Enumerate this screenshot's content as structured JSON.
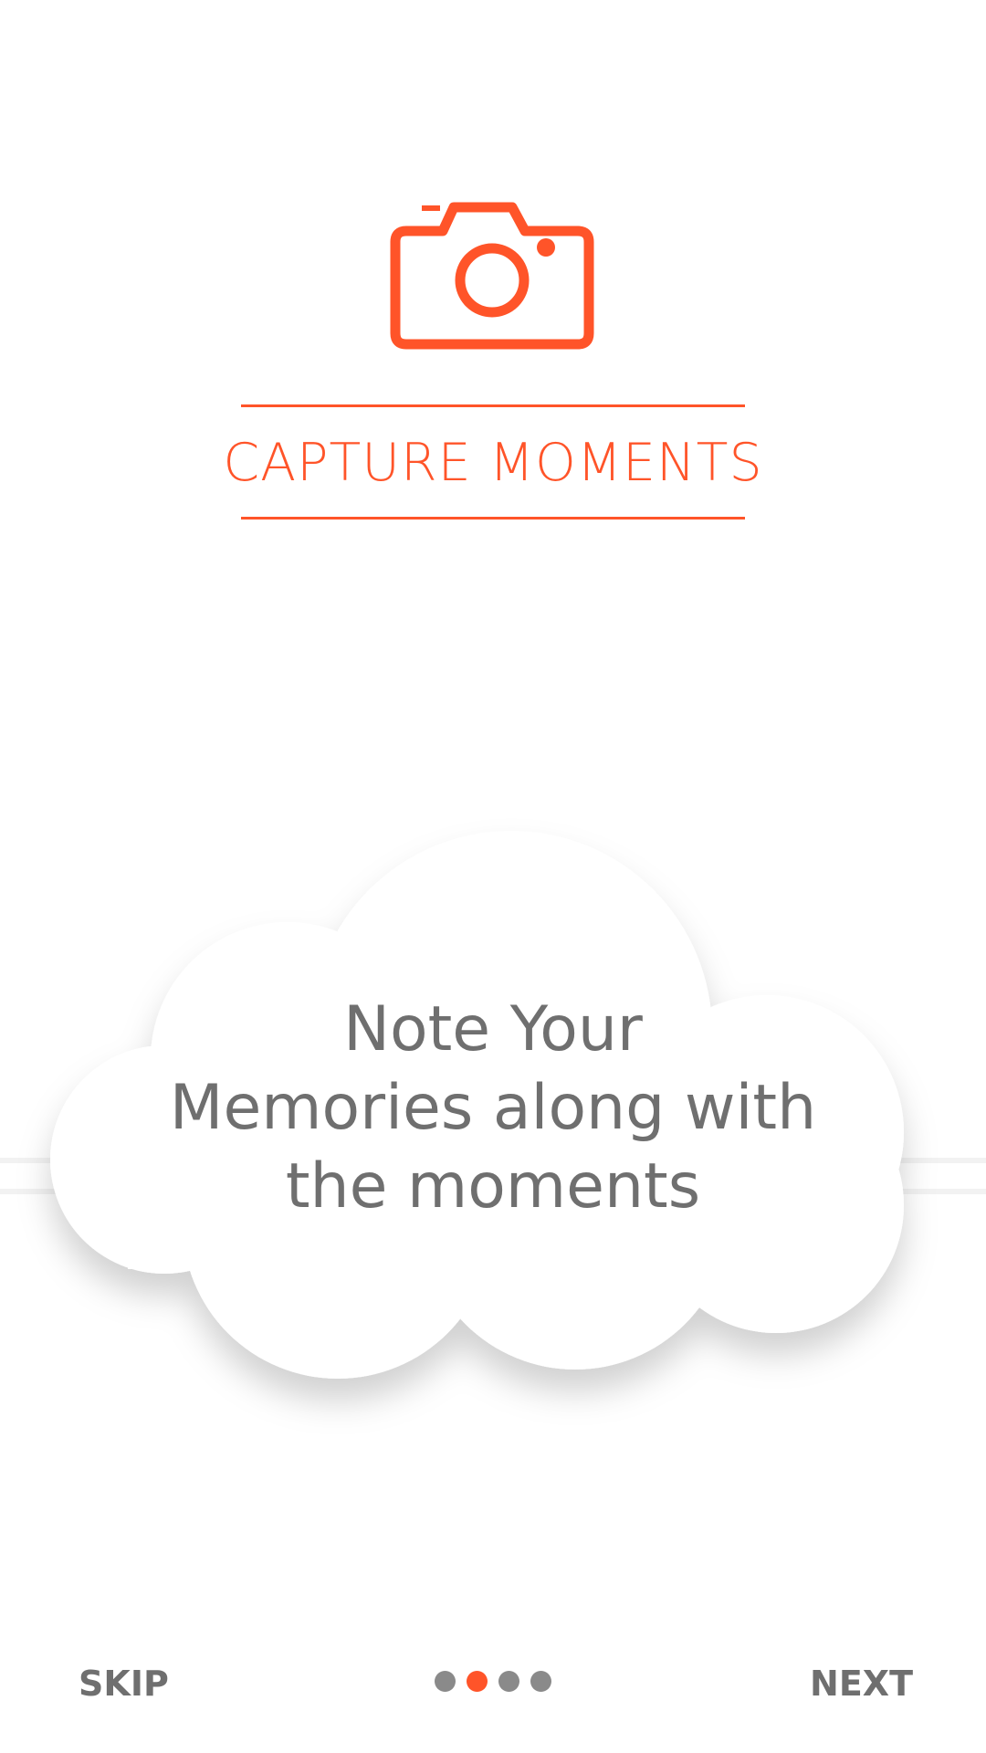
{
  "onboarding": {
    "title": "CAPTURE MOMENTS",
    "icon": "camera-icon",
    "message_lines": [
      "Note Your",
      "Memories along with",
      "the moments"
    ],
    "page_count": 4,
    "active_page_index": 1
  },
  "navigation": {
    "skip_label": "SKIP",
    "next_label": "NEXT"
  },
  "colors": {
    "accent": "#ff5429",
    "text_gray": "#6f6f6f",
    "dot_inactive": "#8a8a8a",
    "background": "#ffffff"
  }
}
